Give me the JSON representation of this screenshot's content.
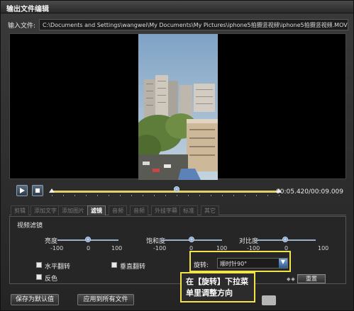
{
  "window": {
    "title": "输出文件编辑"
  },
  "input": {
    "label": "输入文件:",
    "path": "C:\\Documents and Settings\\wangwei\\My Documents\\My Pictures\\iphone5拍摄竖视频\\iphone5拍摄竖视频.MOV"
  },
  "player": {
    "timecode": "00:05.420/00:09.009",
    "progress": 0.55,
    "controls": [
      {
        "name": "play-icon"
      },
      {
        "name": "stop-icon"
      }
    ]
  },
  "tabs": [
    {
      "label": "剪辑",
      "active": false
    },
    {
      "label": "添加文字",
      "active": false
    },
    {
      "label": "添加图片",
      "active": false
    },
    {
      "label": "滤镜",
      "active": true
    },
    {
      "label": "音频",
      "active": false
    },
    {
      "label": "音频",
      "active": false
    },
    {
      "label": "外挂字幕",
      "active": false
    },
    {
      "label": "标准",
      "active": false
    },
    {
      "label": "其它",
      "active": false
    }
  ],
  "filter": {
    "group_title": "视频滤镜",
    "brightness": {
      "label": "亮度",
      "min": "-100",
      "mid": "0",
      "max": "100",
      "value": 0
    },
    "saturation": {
      "label": "饱和度",
      "min": "-100",
      "mid": "0",
      "max": "100",
      "value": 0
    },
    "contrast": {
      "label": "对比度",
      "min": "-100",
      "mid": "0",
      "max": "100",
      "value": 0
    },
    "flip_h": {
      "label": "水平翻转",
      "checked": false
    },
    "flip_v": {
      "label": "垂直翻转",
      "checked": false
    },
    "invert": {
      "label": "反色",
      "checked": false
    },
    "rotate": {
      "label": "旋转:",
      "value": "顺时针90°"
    },
    "reset_label": "重置"
  },
  "annotation": {
    "line1": "在【旋转】下拉菜",
    "line2": "单里调整方向"
  },
  "buttons": {
    "save_default": "保存为默认值",
    "apply_all": "应用到所有文件"
  },
  "colors": {
    "highlight": "#f2e34a",
    "accent": "#4d7aa8"
  }
}
